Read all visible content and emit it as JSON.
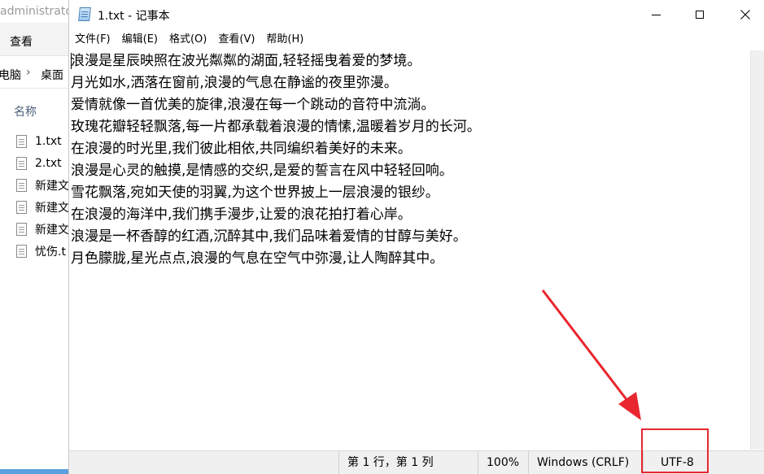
{
  "explorer": {
    "window_title": "administrato",
    "ribbon_view": "查看",
    "address_pc": "电脑",
    "address_separator": "›",
    "address_desktop": "桌面",
    "column_name": "名称",
    "files": [
      {
        "name": "1.txt"
      },
      {
        "name": "2.txt"
      },
      {
        "name": "新建文"
      },
      {
        "name": "新建文"
      },
      {
        "name": "新建文"
      },
      {
        "name": "忧伤.t"
      }
    ]
  },
  "notepad": {
    "title": "1.txt - 记事本",
    "controls": {
      "minimize": "—",
      "maximize": "☐",
      "close": "✕"
    },
    "menu": [
      {
        "label": "文件(F)"
      },
      {
        "label": "编辑(E)"
      },
      {
        "label": "格式(O)"
      },
      {
        "label": "查看(V)"
      },
      {
        "label": "帮助(H)"
      }
    ],
    "lines": [
      "浪漫是星辰映照在波光粼粼的湖面,轻轻摇曳着爱的梦境。",
      "月光如水,洒落在窗前,浪漫的气息在静谧的夜里弥漫。",
      "爱情就像一首优美的旋律,浪漫在每一个跳动的音符中流淌。",
      "玫瑰花瓣轻轻飘落,每一片都承载着浪漫的情愫,温暖着岁月的长河。",
      "在浪漫的时光里,我们彼此相依,共同编织着美好的未来。",
      "浪漫是心灵的触摸,是情感的交织,是爱的誓言在风中轻轻回响。",
      "雪花飘落,宛如天使的羽翼,为这个世界披上一层浪漫的银纱。",
      "在浪漫的海洋中,我们携手漫步,让爱的浪花拍打着心岸。",
      "浪漫是一杯香醇的红酒,沉醉其中,我们品味着爱情的甘醇与美好。",
      "月色朦胧,星光点点,浪漫的气息在空气中弥漫,让人陶醉其中。"
    ],
    "status": {
      "position": "第 1 行，第 1 列",
      "zoom": "100%",
      "line_ending": "Windows (CRLF)",
      "encoding": "UTF-8"
    }
  },
  "annotation": {
    "color": "#e8272f"
  }
}
